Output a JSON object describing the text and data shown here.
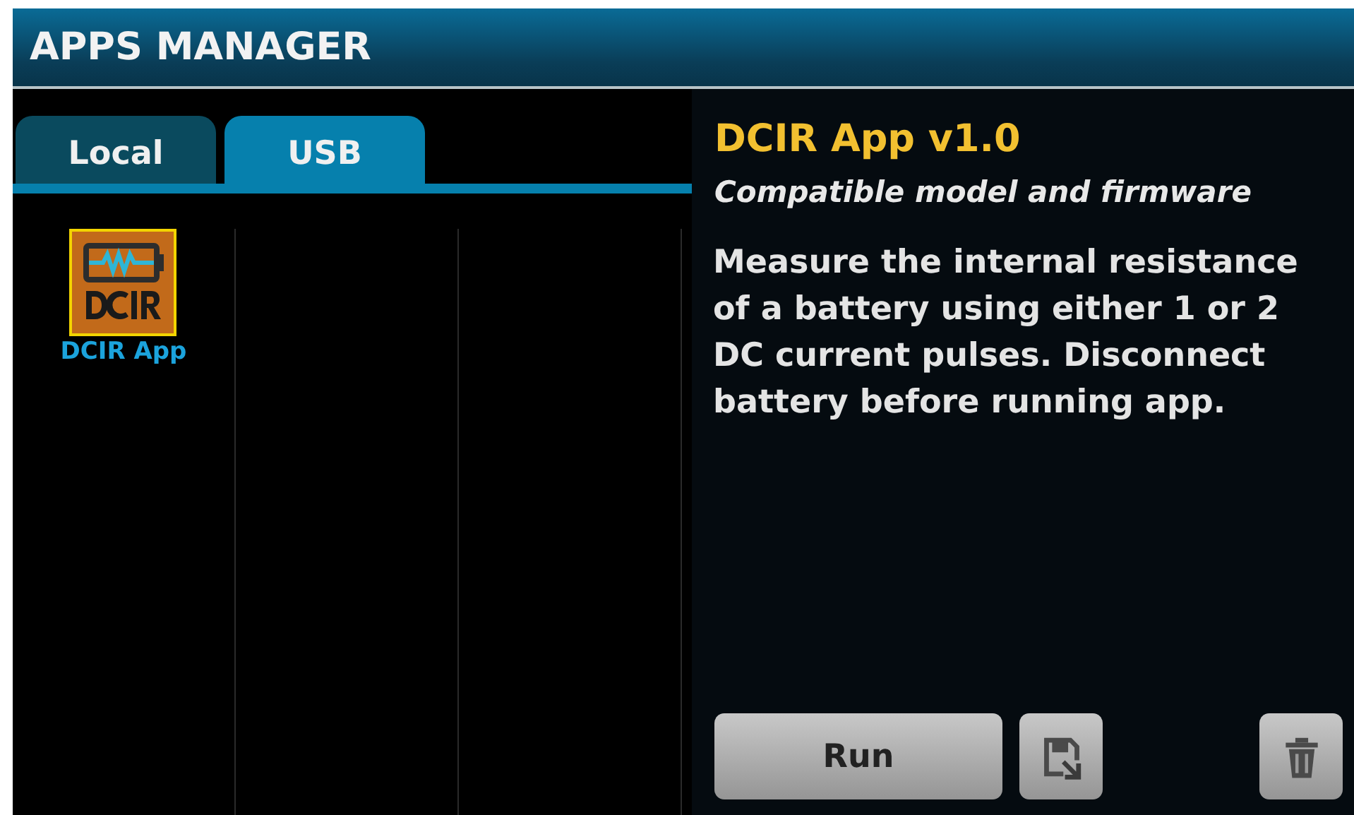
{
  "window": {
    "title": "APPS MANAGER"
  },
  "tabs": [
    {
      "label": "Local",
      "selected": false
    },
    {
      "label": "USB",
      "selected": true
    }
  ],
  "apps": [
    {
      "label": "DCIR App",
      "selected": true
    }
  ],
  "details": {
    "title": "DCIR App v1.0",
    "subtitle": "Compatible model and firmware",
    "description": "Measure the internal resistance of a battery using either 1 or 2 DC current pulses. Disconnect battery before running app."
  },
  "actions": [
    {
      "kind": "text",
      "label": "Run"
    },
    {
      "kind": "save"
    },
    {
      "kind": "delete"
    }
  ]
}
